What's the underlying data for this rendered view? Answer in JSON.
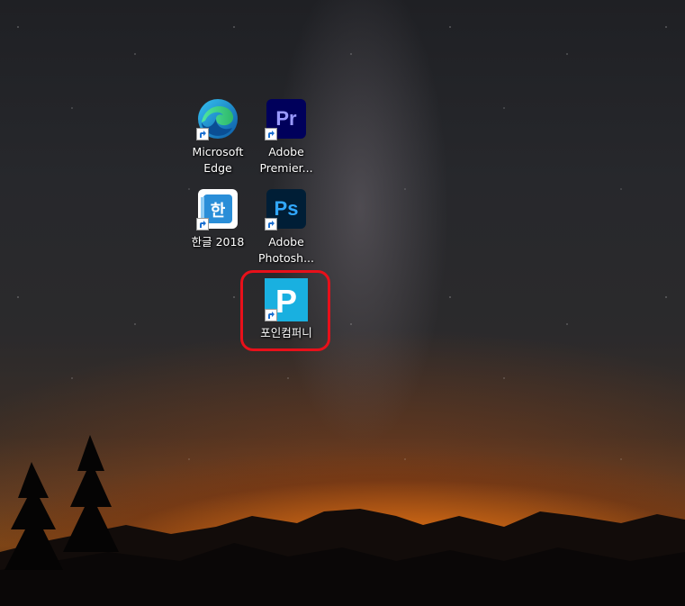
{
  "desktop": {
    "icons": [
      {
        "label": "Microsoft\nEdge",
        "icon": "edge-icon"
      },
      {
        "label": "Adobe\nPremier...",
        "icon": "premiere-icon",
        "abbr": "Pr"
      },
      {
        "label": "한글 2018",
        "icon": "hangul-icon",
        "glyph": "한"
      },
      {
        "label": "Adobe\nPhotosh...",
        "icon": "photoshop-icon",
        "abbr": "Ps"
      },
      {
        "label": "포인컴퍼니",
        "icon": "poincompany-icon",
        "glyph": "P"
      }
    ],
    "highlight_color": "#e8101a"
  },
  "colors": {
    "premiere": "#9999ff",
    "photoshop": "#31a8ff",
    "adobe_bg": "#00005b",
    "poincompany": "#19b0e0"
  }
}
